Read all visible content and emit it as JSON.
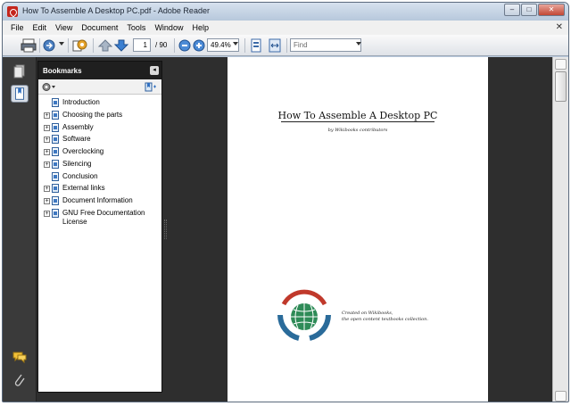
{
  "window": {
    "title": "How To Assemble A Desktop PC.pdf - Adobe Reader"
  },
  "menu": {
    "items": [
      "File",
      "Edit",
      "View",
      "Document",
      "Tools",
      "Window",
      "Help"
    ]
  },
  "toolbar": {
    "page_current": "1",
    "page_total": "/ 90",
    "zoom": "49.4%",
    "find_placeholder": "Find",
    "icons": [
      "print-icon",
      "share-icon",
      "collaborate-icon",
      "previous-page-icon",
      "next-page-icon",
      "zoom-out-icon",
      "zoom-in-icon",
      "fit-page-icon",
      "fit-width-icon"
    ]
  },
  "sidebar": {
    "header": "Bookmarks",
    "bookmarks": [
      {
        "label": "Introduction",
        "expandable": false
      },
      {
        "label": "Choosing the parts",
        "expandable": true
      },
      {
        "label": "Assembly",
        "expandable": true
      },
      {
        "label": "Software",
        "expandable": true
      },
      {
        "label": "Overclocking",
        "expandable": true
      },
      {
        "label": "Silencing",
        "expandable": true
      },
      {
        "label": "Conclusion",
        "expandable": false
      },
      {
        "label": "External links",
        "expandable": true
      },
      {
        "label": "Document Information",
        "expandable": true
      },
      {
        "label": "GNU Free Documentation",
        "label2": "License",
        "expandable": true
      }
    ]
  },
  "document": {
    "title": "How To Assemble A Desktop PC",
    "author": "by Wikibooks contributors",
    "footer_line1": "Created on Wikibooks,",
    "footer_line2": "the open content textbooks collection."
  },
  "colors": {
    "logo_red": "#c0392b",
    "logo_blue": "#2a6b9a",
    "logo_green": "#2e8b57"
  }
}
